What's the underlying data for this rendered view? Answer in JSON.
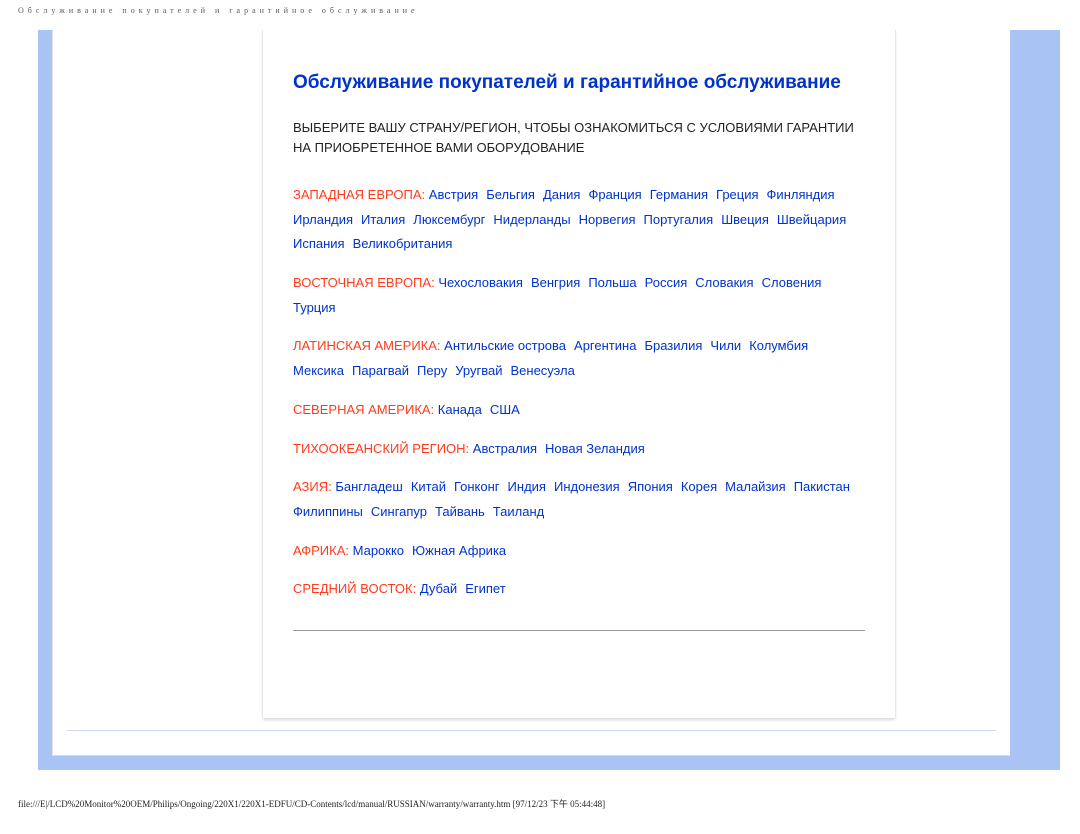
{
  "page_title": "Обслуживание покупателей и гарантийное обслуживание",
  "heading": "Обслуживание покупателей и гарантийное обслуживание",
  "instruction": "ВЫБЕРИТЕ ВАШУ СТРАНУ/РЕГИОН, ЧТОБЫ ОЗНАКОМИТЬСЯ С УСЛОВИЯМИ ГАРАНТИИ НА ПРИОБРЕТЕННОЕ ВАМИ ОБОРУДОВАНИЕ",
  "regions": [
    {
      "label": "ЗАПАДНАЯ ЕВРОПА:",
      "countries": [
        "Австрия",
        "Бельгия",
        "Дания",
        "Франция",
        "Германия",
        "Греция",
        "Финляндия",
        "Ирландия",
        "Италия",
        "Люксембург",
        "Нидерланды",
        "Норвегия",
        "Португалия",
        "Швеция",
        "Швейцария",
        "Испания",
        "Великобритания"
      ]
    },
    {
      "label": "ВОСТОЧНАЯ ЕВРОПА:",
      "countries": [
        "Чехословакия",
        "Венгрия",
        "Польша",
        "Россия",
        "Словакия",
        "Словения",
        "Турция"
      ]
    },
    {
      "label": "ЛАТИНСКАЯ АМЕРИКА:",
      "countries": [
        "Антильские острова",
        "Аргентина",
        "Бразилия",
        "Чили",
        "Колумбия",
        "Мексика",
        "Парагвай",
        "Перу",
        "Уругвай",
        "Венесуэла"
      ]
    },
    {
      "label": "СЕВЕРНАЯ АМЕРИКА:",
      "countries": [
        "Канада",
        "США"
      ]
    },
    {
      "label": "ТИХООКЕАНСКИЙ РЕГИОН:",
      "countries": [
        "Австралия",
        "Новая Зеландия"
      ]
    },
    {
      "label": "АЗИЯ:",
      "countries": [
        "Бангладеш",
        "Китай",
        "Гонконг",
        "Индия",
        "Индонезия",
        "Япония",
        "Корея",
        "Малайзия",
        "Пакистан",
        "Филиппины",
        "Сингапур",
        "Тайвань",
        "Таиланд"
      ]
    },
    {
      "label": "АФРИКА:",
      "countries": [
        "Марокко",
        "Южная Африка"
      ]
    },
    {
      "label": "СРЕДНИЙ ВОСТОК:",
      "countries": [
        "Дубай",
        "Египет"
      ]
    }
  ],
  "footer_path": "file:///E|/LCD%20Monitor%20OEM/Philips/Ongoing/220X1/220X1-EDFU/CD-Contents/lcd/manual/RUSSIAN/warranty/warranty.htm [97/12/23 下午 05:44:48]"
}
